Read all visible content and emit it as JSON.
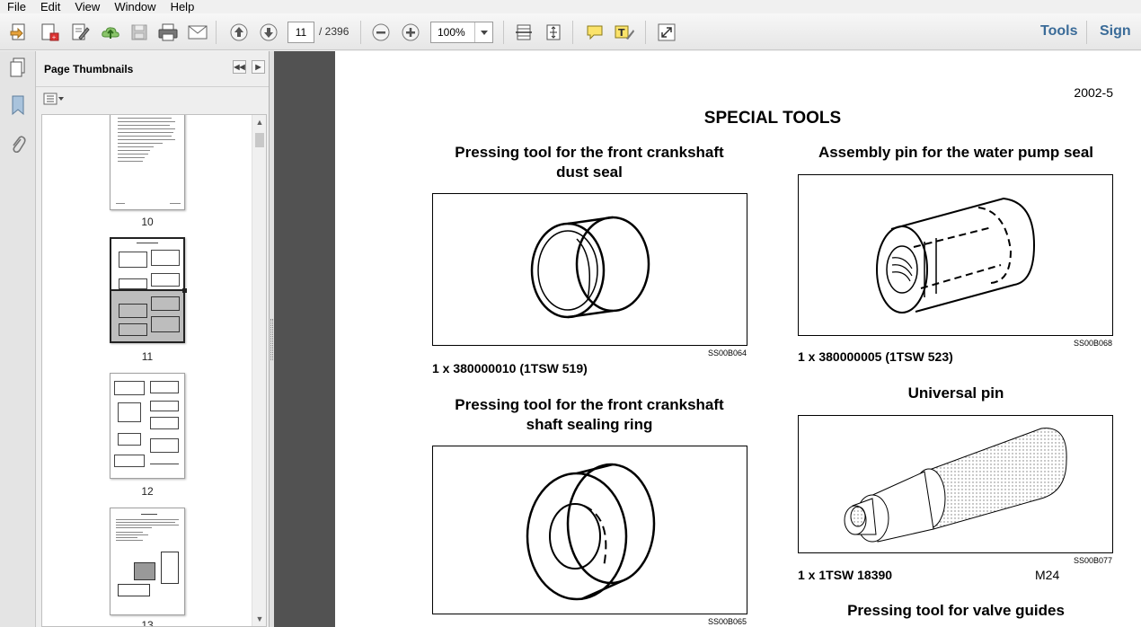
{
  "menu": {
    "file": "File",
    "edit": "Edit",
    "view": "View",
    "window": "Window",
    "help": "Help"
  },
  "toolbar": {
    "page_current": "11",
    "page_total": "/ 2396",
    "zoom": "100%",
    "tools_label": "Tools",
    "sign_label": "Sign"
  },
  "thumbnail_panel": {
    "title": "Page Thumbnails",
    "thumbnails": [
      {
        "label": "10"
      },
      {
        "label": "11"
      },
      {
        "label": "12"
      },
      {
        "label": "13"
      }
    ]
  },
  "document": {
    "page_number": "2002-5",
    "title": "SPECIAL TOOLS",
    "sections": [
      {
        "heading_line1": "Pressing tool for the front crankshaft",
        "heading_line2": "dust seal",
        "figure_code": "SS00B064",
        "part": "1 x 380000010 (1TSW 519)"
      },
      {
        "heading_line1": "Assembly pin for the water pump seal",
        "figure_code": "SS00B068",
        "part": "1 x 380000005 (1TSW 523)"
      },
      {
        "heading_line1": "Pressing tool for the front crankshaft",
        "heading_line2": "shaft sealing ring",
        "figure_code": "SS00B065"
      },
      {
        "heading_line1": "Universal pin",
        "figure_code": "SS00B077",
        "part": "1 x 1TSW 18390",
        "extra": "M24"
      },
      {
        "heading_line1": "Pressing tool for valve guides"
      }
    ]
  }
}
